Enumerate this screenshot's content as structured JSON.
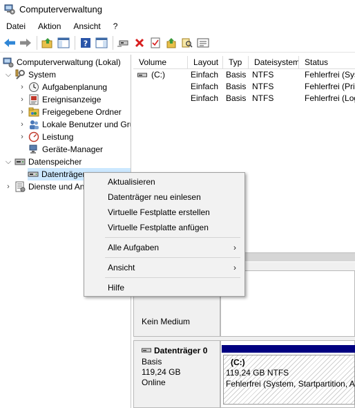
{
  "window": {
    "title": "Computerverwaltung"
  },
  "menubar": {
    "items": [
      "Datei",
      "Aktion",
      "Ansicht",
      "?"
    ]
  },
  "toolbar": {
    "buttons": [
      "back-arrow-icon",
      "forward-arrow-icon",
      "up-folder-icon",
      "show-hide-tree-icon",
      "help-icon",
      "show-action-pane-icon",
      "connect-drive-icon",
      "delete-icon",
      "properties-icon",
      "import-icon",
      "search-icon",
      "disk-list-icon"
    ]
  },
  "tree": {
    "root": "Computerverwaltung (Lokal)",
    "system": "System",
    "aufgabenplanung": "Aufgabenplanung",
    "ereignisanzeige": "Ereignisanzeige",
    "freigegebene_ordner": "Freigegebene Ordner",
    "lokale_benutzer": "Lokale Benutzer und Gru",
    "leistung": "Leistung",
    "geraete_manager": "Geräte-Manager",
    "datenspeicher": "Datenspeicher",
    "datentraeger": "Datenträger",
    "dienste": "Dienste und An"
  },
  "volume_list": {
    "columns": [
      "Volume",
      "Layout",
      "Typ",
      "Dateisystem",
      "Status"
    ],
    "rows": [
      {
        "volume": "(C:)",
        "layout": "Einfach",
        "typ": "Basis",
        "dateisystem": "NTFS",
        "status": "Fehlerfrei (Sys"
      },
      {
        "volume": "",
        "layout": "Einfach",
        "typ": "Basis",
        "dateisystem": "NTFS",
        "status": "Fehlerfrei (Prir"
      },
      {
        "volume": "",
        "layout": "Einfach",
        "typ": "Basis",
        "dateisystem": "NTFS",
        "status": "Fehlerfrei (Log"
      }
    ]
  },
  "disks": {
    "cdrom": {
      "medium": "Kein Medium"
    },
    "disk0": {
      "name": "Datenträger 0",
      "type": "Basis",
      "size": "119,24 GB",
      "state": "Online",
      "partition": {
        "label": "(C:)",
        "size_fs": "119,24 GB NTFS",
        "status": "Fehlerfrei (System, Startpartition, Au"
      }
    }
  },
  "context_menu": {
    "items": [
      "Aktualisieren",
      "Datenträger neu einlesen",
      "Virtuelle Festplatte erstellen",
      "Virtuelle Festplatte anfügen",
      "Alle Aufgaben",
      "Ansicht",
      "Hilfe"
    ]
  },
  "colors": {
    "selection": "#cce8ff",
    "volume_bar": "#000080",
    "delete_red": "#d81e1e"
  }
}
